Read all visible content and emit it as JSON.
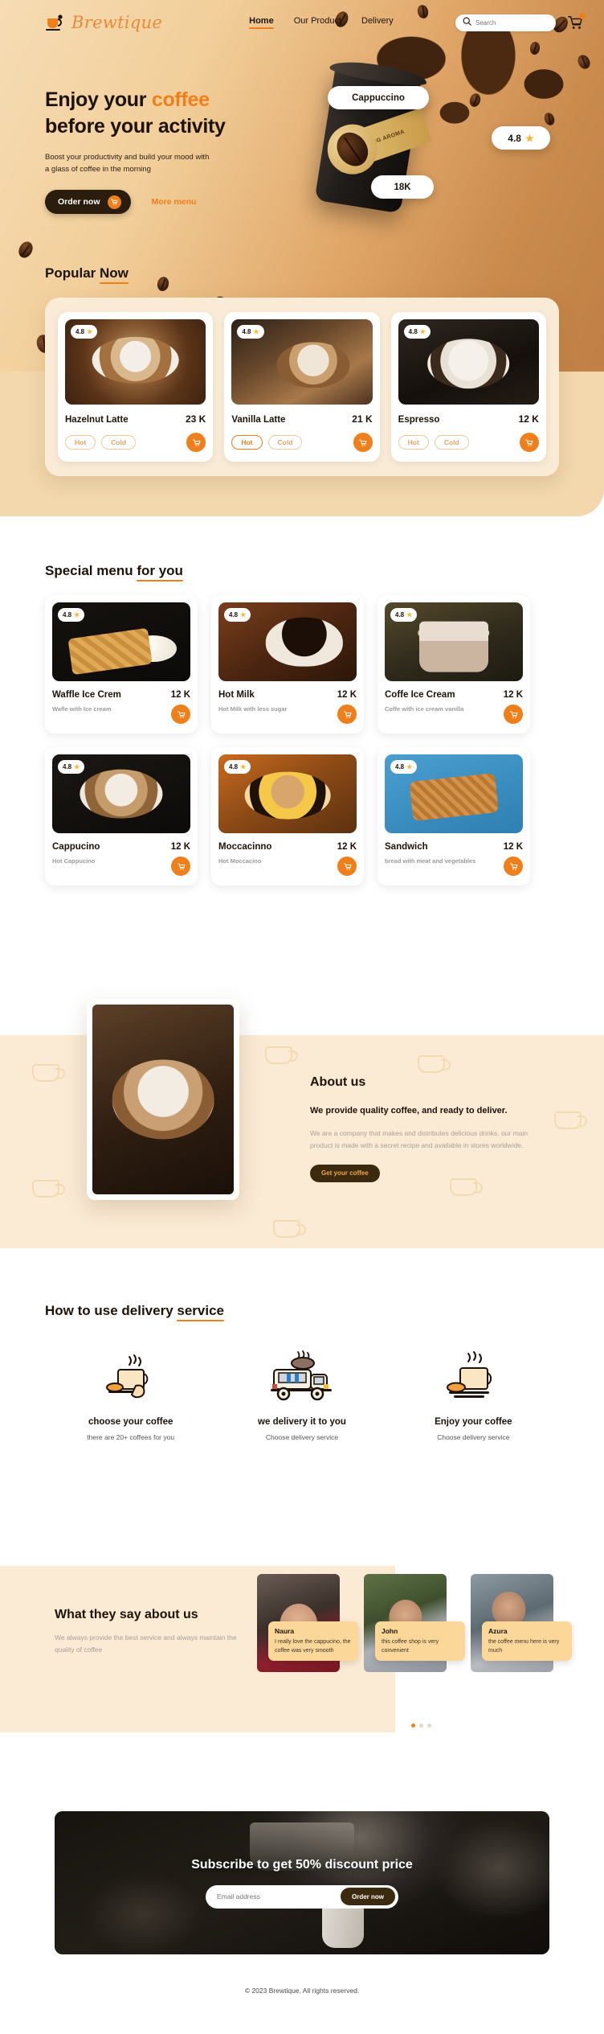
{
  "brand": {
    "name": "Brewtique",
    "logo_icon": "coffee-cup-icon"
  },
  "nav": {
    "links": [
      {
        "label": "Home",
        "active": true
      },
      {
        "label": "Our Product",
        "active": false
      },
      {
        "label": "Delivery",
        "active": false
      }
    ],
    "search": {
      "placeholder": "Search",
      "value": "",
      "icon": "search-icon"
    },
    "cart": {
      "icon": "cart-icon",
      "badge": ""
    }
  },
  "hero": {
    "title_line1_a": "Enjoy your ",
    "title_line1_b": "coffee",
    "title_line2": "before your activity",
    "subtitle": "Boost your productivity and build your mood with a glass of coffee in the morning",
    "order_label": "Order now",
    "order_icon": "cart-icon",
    "more_label": "More menu",
    "badge_product": "Cappuccino",
    "badge_rating": "4.8",
    "badge_rating_icon": "star-icon",
    "badge_count": "18K",
    "cup_label": "STRONG AROMA"
  },
  "popular": {
    "heading_a": "Popular ",
    "heading_b": "Now",
    "cards": [
      {
        "name": "Hazelnut Latte",
        "price": "23 K",
        "rating": "4.8",
        "hot": "Hot",
        "cold": "Cold",
        "selected": "",
        "photo": "ph-hazelnut"
      },
      {
        "name": "Vanilla Latte",
        "price": "21 K",
        "rating": "4.8",
        "hot": "Hot",
        "cold": "Cold",
        "selected": "hot",
        "photo": "ph-vanilla"
      },
      {
        "name": "Espresso",
        "price": "12 K",
        "rating": "4.8",
        "hot": "Hot",
        "cold": "Cold",
        "selected": "",
        "photo": "ph-espresso"
      }
    ]
  },
  "special": {
    "heading_a": "Special menu ",
    "heading_b": "for you",
    "cards": [
      {
        "name": "Waffle Ice Crem",
        "price": "12 K",
        "rating": "4.8",
        "desc": "Wafle with Ice cream",
        "photo": "ph-waffle"
      },
      {
        "name": "Hot Milk",
        "price": "12 K",
        "rating": "4.8",
        "desc": "Hot Milk with less sugar",
        "photo": "ph-hotmilk"
      },
      {
        "name": "Coffe Ice Cream",
        "price": "12 K",
        "rating": "4.8",
        "desc": "Coffe with ice cream vanilla",
        "photo": "ph-coffeeice"
      },
      {
        "name": "Cappucino",
        "price": "12 K",
        "rating": "4.8",
        "desc": "Hot Cappucino",
        "photo": "ph-cappucino"
      },
      {
        "name": "Moccacinno",
        "price": "12 K",
        "rating": "4.8",
        "desc": "Hot Moccacino",
        "photo": "ph-moccacinno"
      },
      {
        "name": "Sandwich",
        "price": "12 K",
        "rating": "4.8",
        "desc": "bread with meat and vegetables",
        "photo": "ph-sandwich"
      }
    ]
  },
  "about": {
    "heading_a": "About ",
    "heading_b": "us",
    "lead": "We provide quality coffee, and ready to deliver.",
    "body": "We are a company that makes and distributes delicious drinks. our main product is made with a secret recipe and available in stores worldwide.",
    "cta": "Get your coffee"
  },
  "delivery": {
    "heading_a": "How to use delivery ",
    "heading_b": "service",
    "steps": [
      {
        "icon": "coffee-cup-hand-icon",
        "title": "choose your coffee",
        "desc": "there are 20+ coffees for you"
      },
      {
        "icon": "delivery-truck-icon",
        "title": "we delivery it to you",
        "desc": "Choose delivery service"
      },
      {
        "icon": "hot-coffee-cup-icon",
        "title": "Enjoy your coffee",
        "desc": "Choose delivery service"
      }
    ]
  },
  "testimonials": {
    "heading": "What they say about us",
    "subtitle": "We always provide the best service and always maintain the quality of coffee",
    "items": [
      {
        "name": "Naura",
        "text": "I really love the cappucino, the coffee was very smooth",
        "photo": "ph-naura"
      },
      {
        "name": "John",
        "text": "this coffee shop is very convenient",
        "photo": "ph-john"
      },
      {
        "name": "Azura",
        "text": "the coffee menu here is very much",
        "photo": "ph-azura"
      }
    ],
    "dots": 3,
    "active_dot": 0
  },
  "subscribe": {
    "title": "Subscribe to get 50% discount price",
    "email_placeholder": "Email address",
    "email_value": "",
    "button": "Order now"
  },
  "footer": {
    "copyright": "© 2023 Brewtique. All rights reserved."
  },
  "colors": {
    "accent": "#ef7f1a",
    "dark": "#2b1d0e",
    "cream": "#fbead4",
    "star": "#f4b731"
  }
}
